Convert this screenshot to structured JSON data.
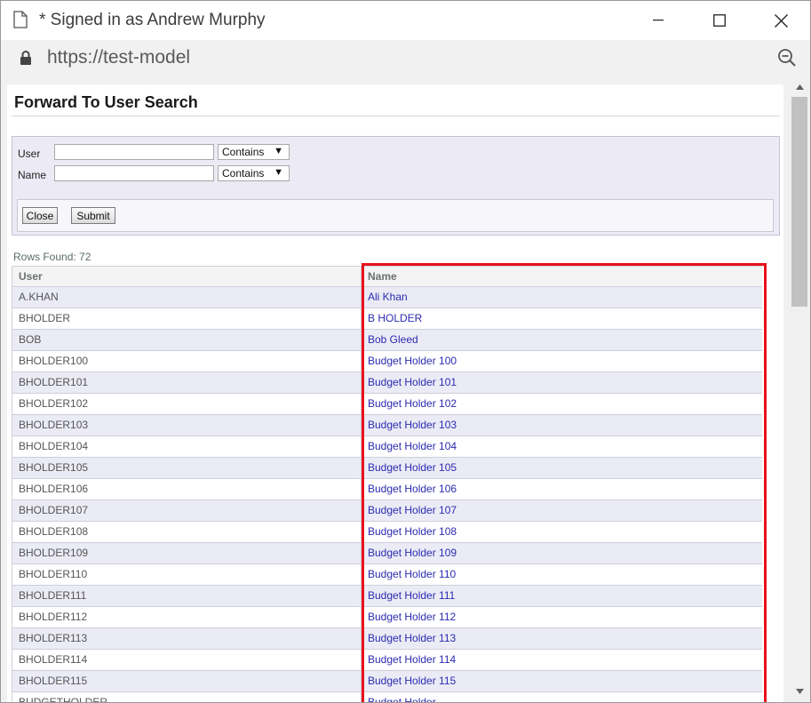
{
  "window": {
    "title": "* Signed in as Andrew Murphy",
    "url": "https://test-model"
  },
  "page": {
    "title": "Forward To User Search"
  },
  "search": {
    "user_label": "User",
    "user_value": "",
    "user_operator": "Contains",
    "name_label": "Name",
    "name_value": "",
    "name_operator": "Contains",
    "close_label": "Close",
    "submit_label": "Submit"
  },
  "results": {
    "rows_found": "Rows Found: 72",
    "columns": [
      "User",
      "Name"
    ],
    "rows": [
      {
        "user": "A.KHAN",
        "name": "Ali Khan"
      },
      {
        "user": "BHOLDER",
        "name": "B HOLDER"
      },
      {
        "user": "BOB",
        "name": "Bob Gleed"
      },
      {
        "user": "BHOLDER100",
        "name": "Budget Holder 100"
      },
      {
        "user": "BHOLDER101",
        "name": "Budget Holder 101"
      },
      {
        "user": "BHOLDER102",
        "name": "Budget Holder 102"
      },
      {
        "user": "BHOLDER103",
        "name": "Budget Holder 103"
      },
      {
        "user": "BHOLDER104",
        "name": "Budget Holder 104"
      },
      {
        "user": "BHOLDER105",
        "name": "Budget Holder 105"
      },
      {
        "user": "BHOLDER106",
        "name": "Budget Holder 106"
      },
      {
        "user": "BHOLDER107",
        "name": "Budget Holder 107"
      },
      {
        "user": "BHOLDER108",
        "name": "Budget Holder 108"
      },
      {
        "user": "BHOLDER109",
        "name": "Budget Holder 109"
      },
      {
        "user": "BHOLDER110",
        "name": "Budget Holder 110"
      },
      {
        "user": "BHOLDER111",
        "name": "Budget Holder 111"
      },
      {
        "user": "BHOLDER112",
        "name": "Budget Holder 112"
      },
      {
        "user": "BHOLDER113",
        "name": "Budget Holder 113"
      },
      {
        "user": "BHOLDER114",
        "name": "Budget Holder 114"
      },
      {
        "user": "BHOLDER115",
        "name": "Budget Holder 115"
      },
      {
        "user": "BUDGETHOLDER",
        "name": "Budget.Holder"
      }
    ]
  },
  "icons": {
    "document": "document-icon",
    "lock": "lock-icon",
    "zoom": "zoom-out-icon",
    "minimize": "minimize-icon",
    "maximize": "maximize-icon",
    "close": "close-icon"
  },
  "colors": {
    "link": "#2b2bb0",
    "highlight_border": "#e8121c",
    "row_alt": "#ebebf6",
    "panel_bg": "#eceaf4"
  }
}
